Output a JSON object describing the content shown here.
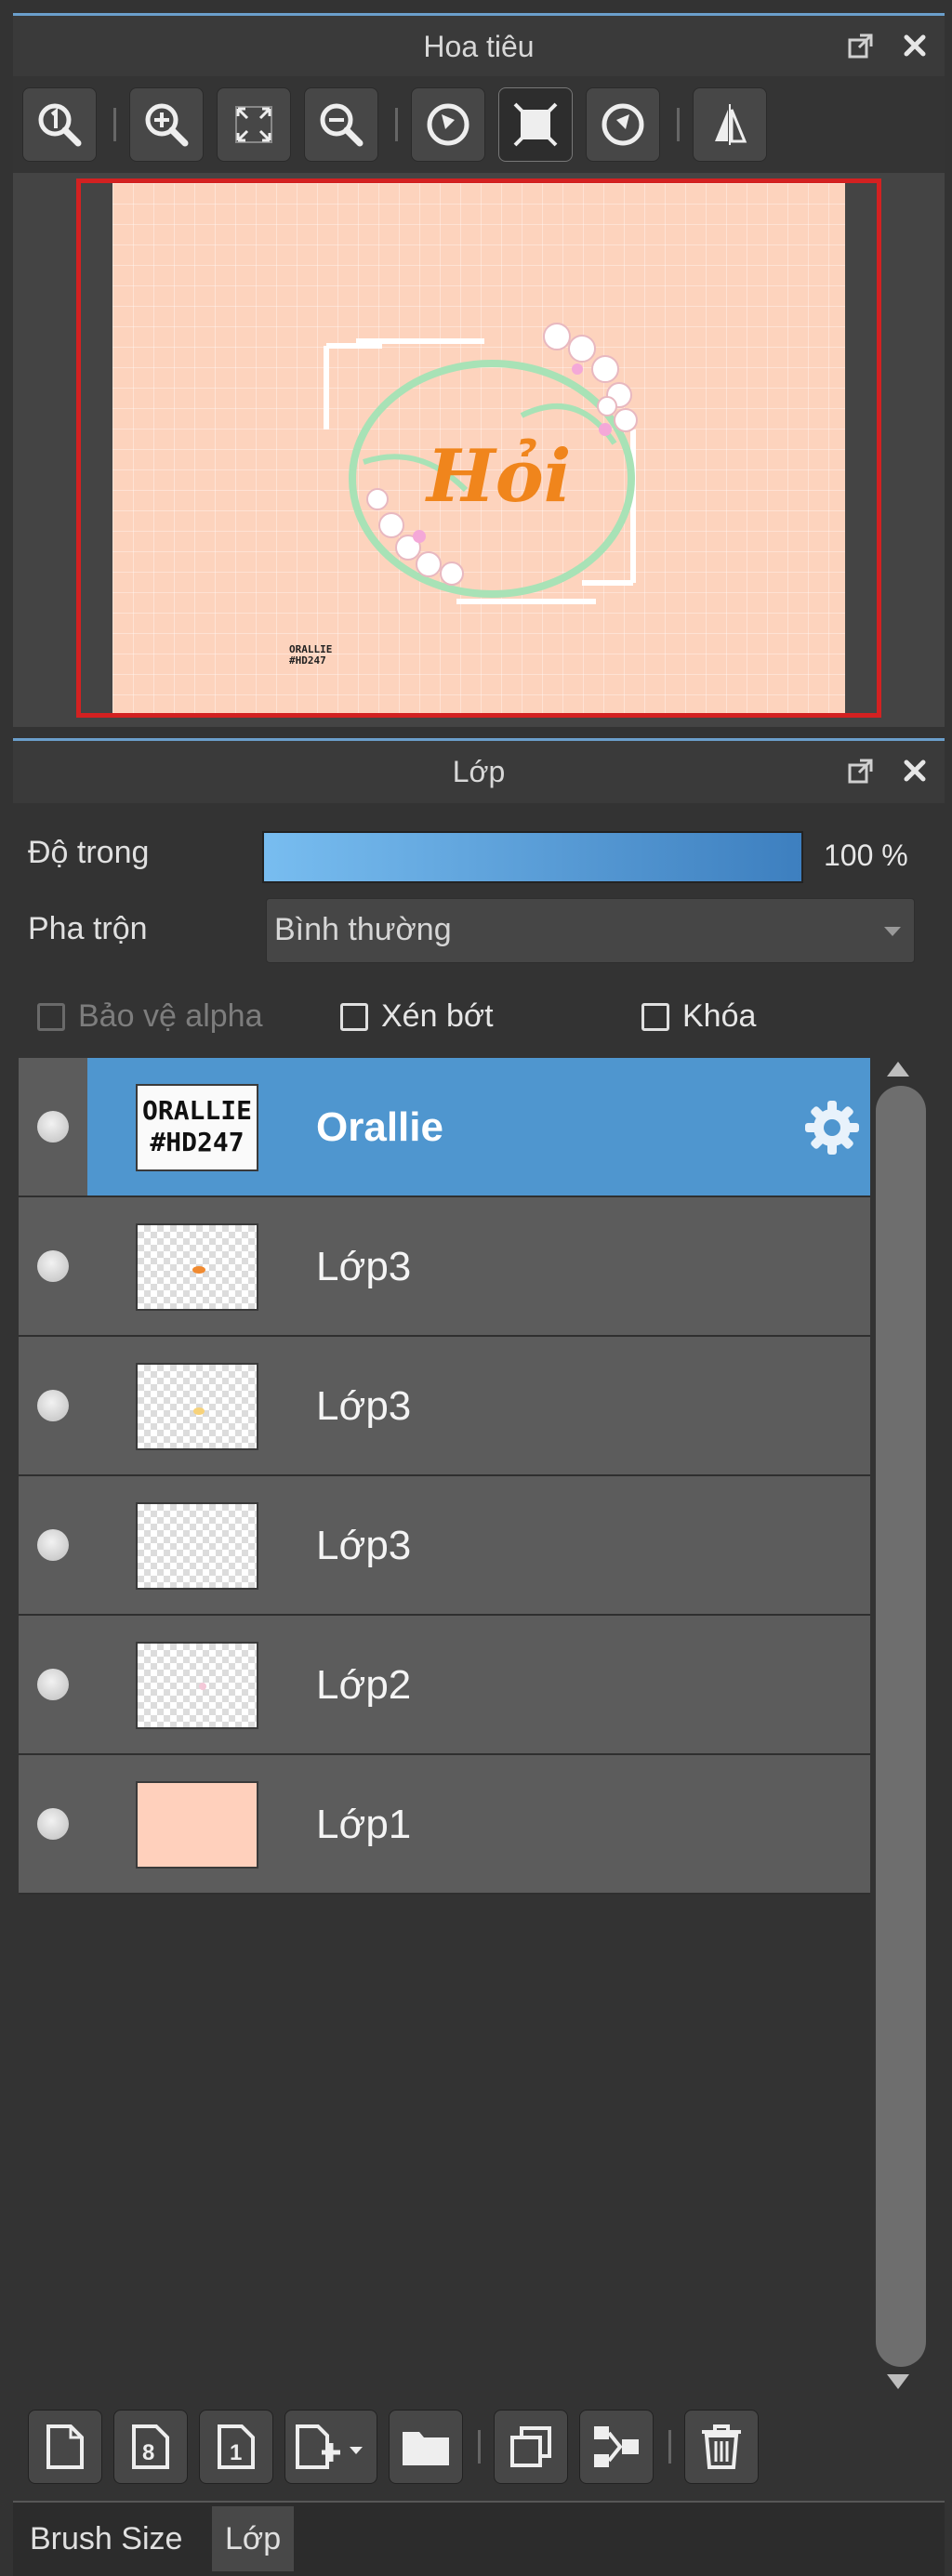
{
  "navigator": {
    "title": "Hoa tiêu",
    "tools": [
      {
        "icon": "zoom-actual-size-icon"
      },
      {
        "icon": "zoom-in-icon"
      },
      {
        "icon": "fit-to-window-icon"
      },
      {
        "icon": "zoom-out-icon"
      },
      {
        "icon": "rotate-left-icon"
      },
      {
        "icon": "reset-rotation-icon"
      },
      {
        "icon": "rotate-right-icon"
      },
      {
        "icon": "flip-horizontal-icon"
      }
    ],
    "preview": {
      "artwork_text": "Hỏi",
      "signature_line1": "ORALLIE",
      "signature_line2": "#HD247"
    }
  },
  "layers_panel": {
    "title": "Lớp",
    "opacity_label": "Độ trong",
    "opacity_value_text": "100 %",
    "opacity_fraction": 1.0,
    "blend_label": "Pha trộn",
    "blend_value": "Bình thường",
    "checks": {
      "protect_alpha": "Bảo vệ alpha",
      "clipping": "Xén bớt",
      "lock": "Khóa"
    },
    "layers": [
      {
        "name": "Orallie",
        "thumb_line1": "ORALLIE",
        "thumb_line2": "#HD247",
        "selected": true
      },
      {
        "name": "Lớp3"
      },
      {
        "name": "Lớp3"
      },
      {
        "name": "Lớp3"
      },
      {
        "name": "Lớp2"
      },
      {
        "name": "Lớp1"
      }
    ]
  },
  "bottom_tools": [
    {
      "icon": "new-layer-icon"
    },
    {
      "icon": "new-8bit-layer-icon"
    },
    {
      "icon": "new-1bit-layer-icon"
    },
    {
      "icon": "add-layer-menu-icon"
    },
    {
      "icon": "folder-icon"
    },
    {
      "icon": "duplicate-layer-icon"
    },
    {
      "icon": "merge-down-icon"
    },
    {
      "icon": "delete-layer-icon"
    }
  ],
  "dock_tabs": {
    "brush_size": "Brush Size",
    "layers": "Lớp"
  },
  "colors": {
    "accent": "#4f96cf",
    "canvas_bg": "#fdd3bd",
    "artwork_orange": "#f0851c",
    "preview_border": "#d32121"
  }
}
